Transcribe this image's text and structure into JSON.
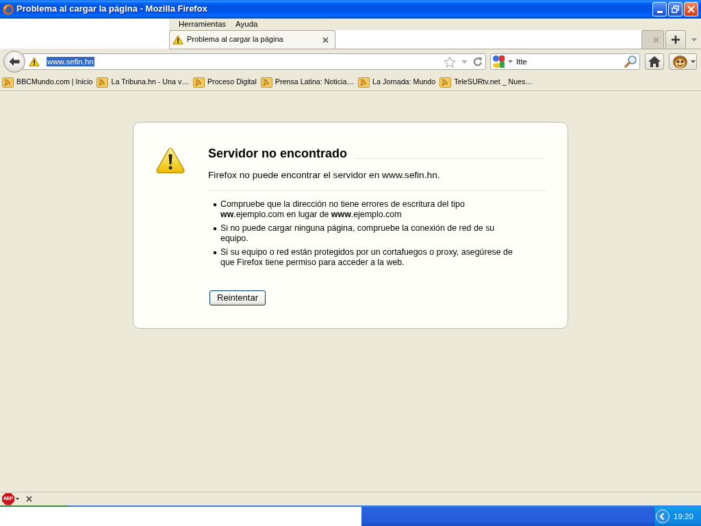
{
  "window": {
    "title": "Problema al cargar la página - Mozilla Firefox"
  },
  "menu": [
    {
      "label": "Herramientas"
    },
    {
      "label": "Ayuda"
    }
  ],
  "tabs": [
    {
      "title": "Problema al cargar la página",
      "selected": true
    },
    {
      "selected": false
    }
  ],
  "address_bar": {
    "value": "www.sefin.hn",
    "text_selected": true
  },
  "search_bar": {
    "value": "Itte"
  },
  "bookmarks": [
    {
      "label": "BBCMundo.com | Inicio"
    },
    {
      "label": "La Tribuna.hn - Una v…"
    },
    {
      "label": "Proceso Digital"
    },
    {
      "label": "Prensa Latina: Noticia…"
    },
    {
      "label": "La Jornada: Mundo"
    },
    {
      "label": "TeleSURtv.net _ Nues…"
    }
  ],
  "error_page": {
    "title": "Servidor no encontrado",
    "message": "Firefox no puede encontrar el servidor en www.sefin.hn.",
    "suggestions": [
      "Compruebe que la dirección no tiene errores de escritura del tipo **ww**.ejemplo.com en lugar de **www**.ejemplo.com",
      "Si no puede cargar ninguna página, compruebe la conexión de red de su equipo.",
      "Si su equipo o red están protegidos por un cortafuegos o proxy, asegúrese de que Firefox tiene permiso para acceder a la web."
    ],
    "retry_button": "Reintentar"
  },
  "addon_bar": {
    "adblock_label": "ABP"
  },
  "taskbar": {
    "clock": "19:20"
  }
}
